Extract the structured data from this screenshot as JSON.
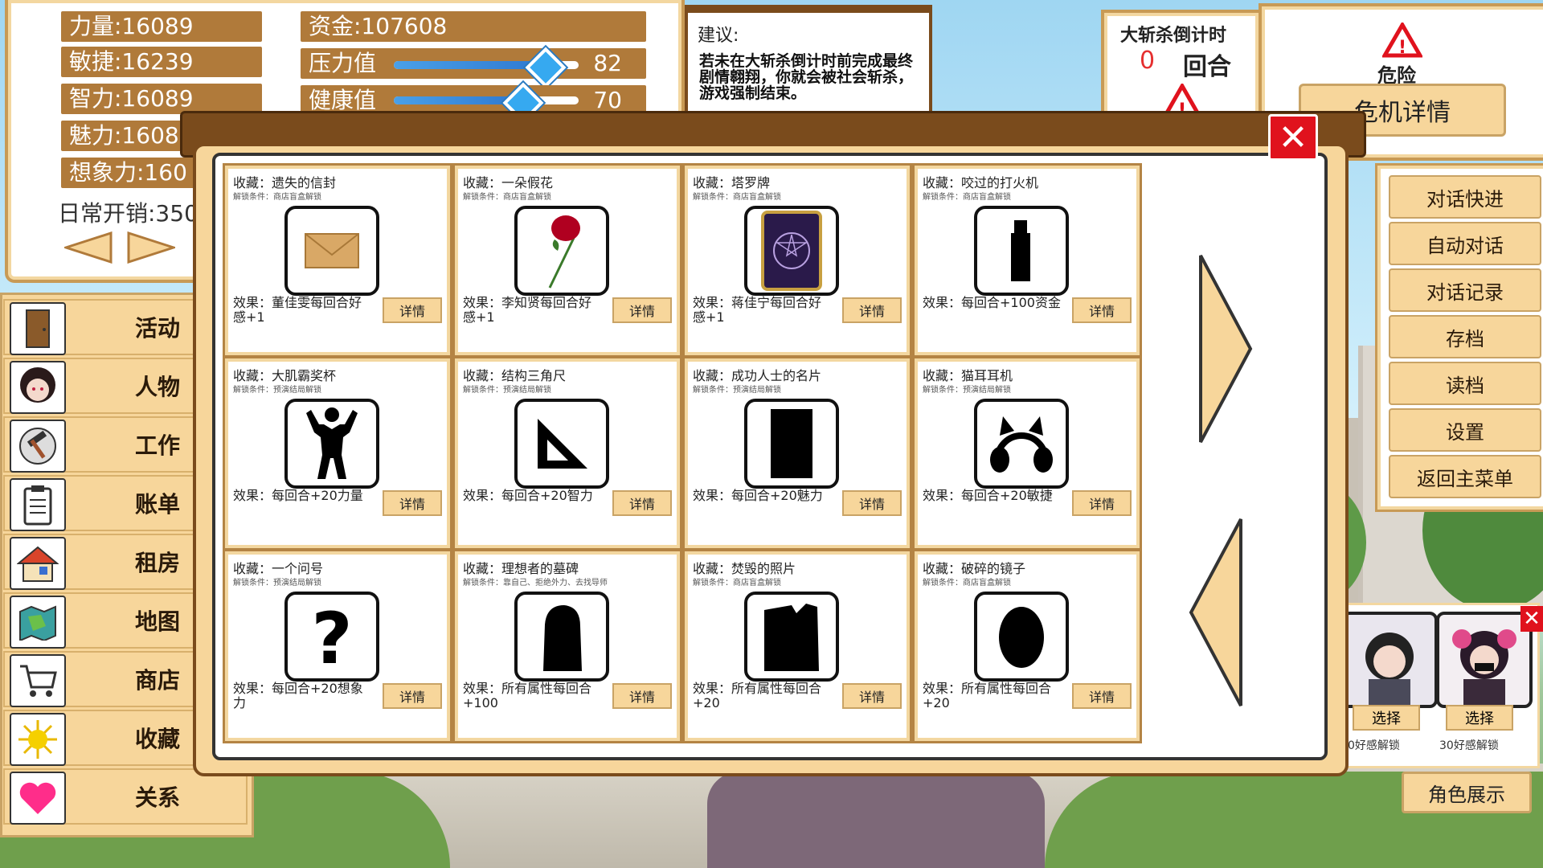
{
  "stats": {
    "strength": "力量:16089",
    "agility": "敏捷:16239",
    "intelligence": "智力:16089",
    "charm": "魅力:1608",
    "imagination": "想象力:160",
    "daily_cost": "日常开销:350",
    "money": "资金:107608",
    "pressure_label": "压力值",
    "pressure_value": "82",
    "pressure_level": 0.82,
    "health_label": "健康值",
    "health_value": "70",
    "health_level": 0.7
  },
  "advice": {
    "title": "建议:",
    "text": "若未在大斩杀倒计时前完成最终剧情翱翔，你就会被社会斩杀，游戏强制结束。"
  },
  "countdown": {
    "title": "大斩杀倒计时",
    "value": "0",
    "unit": "回合"
  },
  "danger": {
    "label": "危险",
    "button": "危机详情"
  },
  "left_menu": [
    {
      "label": "活动",
      "icon": "door-icon"
    },
    {
      "label": "人物",
      "icon": "character-portrait-icon"
    },
    {
      "label": "工作",
      "icon": "hammer-icon"
    },
    {
      "label": "账单",
      "icon": "clipboard-icon"
    },
    {
      "label": "租房",
      "icon": "house-icon"
    },
    {
      "label": "地图",
      "icon": "map-icon"
    },
    {
      "label": "商店",
      "icon": "cart-icon"
    },
    {
      "label": "收藏",
      "icon": "sun-icon"
    },
    {
      "label": "关系",
      "icon": "heart-icon"
    }
  ],
  "right_menu": [
    "对话快进",
    "自动对话",
    "对话记录",
    "存档",
    "读档",
    "设置",
    "返回主菜单"
  ],
  "collection": [
    {
      "name": "收藏：遗失的信封",
      "cond": "解锁条件：商店盲盒解锁",
      "effect": "效果：董佳雯每回合好感+1",
      "icon": "envelope-icon"
    },
    {
      "name": "收藏：一朵假花",
      "cond": "解锁条件：商店盲盒解锁",
      "effect": "效果：李知贤每回合好感+1",
      "icon": "rose-icon"
    },
    {
      "name": "收藏：塔罗牌",
      "cond": "解锁条件：商店盲盒解锁",
      "effect": "效果：蒋佳宁每回合好感+1",
      "icon": "tarot-card-icon"
    },
    {
      "name": "收藏：咬过的打火机",
      "cond": "解锁条件：商店盲盒解锁",
      "effect": "效果：每回合+100资金",
      "icon": "lighter-silhouette-icon"
    },
    {
      "name": "收藏：大肌霸奖杯",
      "cond": "解锁条件：预演结局解锁",
      "effect": "效果：每回合+20力量",
      "icon": "bodybuilder-silhouette-icon"
    },
    {
      "name": "收藏：结构三角尺",
      "cond": "解锁条件：预演结局解锁",
      "effect": "效果：每回合+20智力",
      "icon": "triangle-ruler-icon"
    },
    {
      "name": "收藏：成功人士的名片",
      "cond": "解锁条件：预演结局解锁",
      "effect": "效果：每回合+20魅力",
      "icon": "business-card-silhouette-icon"
    },
    {
      "name": "收藏：猫耳耳机",
      "cond": "解锁条件：预演结局解锁",
      "effect": "效果：每回合+20敏捷",
      "icon": "cat-ear-headphones-icon"
    },
    {
      "name": "收藏：一个问号",
      "cond": "解锁条件：预演结局解锁",
      "effect": "效果：每回合+20想象力",
      "icon": "question-mark-icon"
    },
    {
      "name": "收藏：理想者的墓碑",
      "cond": "解锁条件：靠自己、拒绝外力、去找导师",
      "effect": "效果：所有属性每回合+100",
      "icon": "tombstone-silhouette-icon"
    },
    {
      "name": "收藏：焚毁的照片",
      "cond": "解锁条件：商店盲盒解锁",
      "effect": "效果：所有属性每回合+20",
      "icon": "burnt-photo-silhouette-icon"
    },
    {
      "name": "收藏：破碎的镜子",
      "cond": "解锁条件：商店盲盒解锁",
      "effect": "效果：所有属性每回合+20",
      "icon": "mirror-silhouette-icon"
    }
  ],
  "detail_label": "详情",
  "character_select": {
    "select_label": "选择",
    "unlock_left": "0好感解锁",
    "unlock_right": "30好感解锁",
    "show_button": "角色展示"
  },
  "colors": {
    "panel_brown": "#b07a3a",
    "button_tan": "#f7d69b",
    "modal_frame": "#7a4b1c",
    "close_red": "#e0121d"
  }
}
